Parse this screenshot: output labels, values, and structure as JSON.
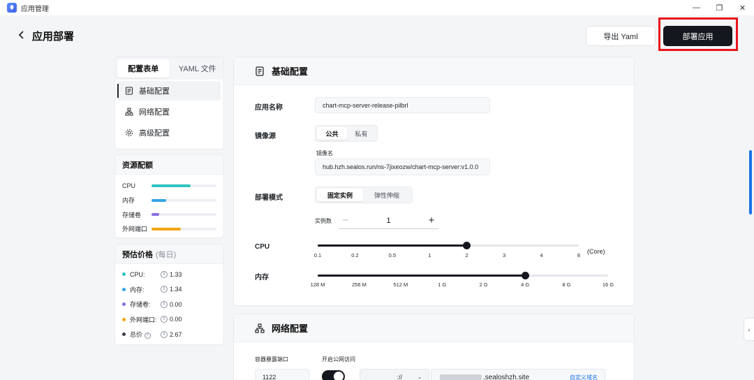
{
  "window": {
    "title": "应用管理",
    "icon": "rocket-icon",
    "controls": [
      "minimize-icon",
      "restore-icon",
      "close-icon"
    ]
  },
  "header": {
    "title": "应用部署",
    "export_label": "导出 Yaml",
    "deploy_label": "部署应用",
    "highlight_color": "#e8141c"
  },
  "nav": {
    "tabs": [
      "配置表单",
      "YAML 文件"
    ],
    "active_tab": "配置表单",
    "items": [
      {
        "label": "基础配置",
        "icon": "document-icon",
        "active": true
      },
      {
        "label": "网络配置",
        "icon": "network-icon",
        "active": false
      },
      {
        "label": "高级配置",
        "icon": "gear-icon",
        "active": false
      }
    ]
  },
  "resources": {
    "title": "资源配额",
    "items": [
      {
        "label": "CPU",
        "percent": 60,
        "color": "#2ec4c0"
      },
      {
        "label": "内存",
        "percent": 23,
        "color": "#36a3e6"
      },
      {
        "label": "存储卷",
        "percent": 12,
        "color": "#8a6ee0"
      },
      {
        "label": "外网端口",
        "percent": 45,
        "color": "#f5a614"
      }
    ]
  },
  "price": {
    "title": "预估价格",
    "period": "(每日)",
    "items": [
      {
        "label": "CPU:",
        "value": "1.33",
        "color": "#2ec4c0"
      },
      {
        "label": "内存:",
        "value": "1.34",
        "color": "#36a3e6"
      },
      {
        "label": "存储卷:",
        "value": "0.00",
        "color": "#8a6ee0"
      },
      {
        "label": "外网端口:",
        "value": "0.00",
        "color": "#f5a614"
      },
      {
        "label": "总价",
        "value": "2.67",
        "color": "#3b4049",
        "help": "?"
      }
    ]
  },
  "basic": {
    "title": "基础配置",
    "app_name_label": "应用名称",
    "app_name_value": "chart-mcp-server-release-pilbrl",
    "image_source_label": "镜像源",
    "image_source_options": [
      "公共",
      "私有"
    ],
    "image_source_selected": "公共",
    "image_name_label": "镜像名",
    "image_name_value": "hub.hzh.sealos.run/ns-7jixeozw/chart-mcp-server:v1.0.0",
    "deploy_mode_label": "部署模式",
    "deploy_mode_options": [
      "固定实例",
      "弹性伸缩"
    ],
    "deploy_mode_selected": "固定实例",
    "replicas_label": "实例数",
    "replicas_value": "1",
    "cpu_label": "CPU",
    "cpu_ticks": [
      "0.1",
      "0.2",
      "0.5",
      "1",
      "2",
      "3",
      "4",
      "8"
    ],
    "cpu_selected_index": 4,
    "cpu_unit": "(Core)",
    "memory_label": "内存",
    "memory_ticks": [
      "128 M",
      "256 M",
      "512 M",
      "1 G",
      "2 G",
      "4 G",
      "8 G",
      "16 G"
    ],
    "memory_selected_index": 5
  },
  "network": {
    "title": "网络配置",
    "port_label": "容器暴露端口",
    "public_access_label": "开启公网访问",
    "port_value": "1122",
    "protocol_value": "://",
    "domain_value": ".sealoshzh.site",
    "custom_domain_label": "自定义域名"
  },
  "side_tab_icon": "chevron-left-icon"
}
